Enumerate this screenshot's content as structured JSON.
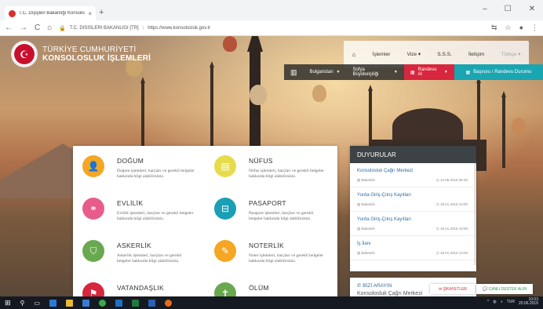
{
  "browser": {
    "tab_title": "T.C. Dışişleri Bakanlığı Konsolos",
    "tab_close": "×",
    "new_tab": "+",
    "nav_back": "←",
    "nav_forward": "→",
    "nav_reload": "C",
    "nav_home": "⌂",
    "security_label": "T.C. DISISLERI BAKANLIGI [TR]",
    "url": "https://www.konsolosluk.gov.tr",
    "window_minimize": "–",
    "window_maximize": "☐",
    "window_close": "✕"
  },
  "site": {
    "logo_line1": "TÜRKİYE CUMHURİYETİ",
    "logo_line2": "KONSOLOSLUK İŞLEMLERİ",
    "accent_red": "#d7263d",
    "accent_teal": "#1aa5b2"
  },
  "topnav": {
    "items": [
      "İşlemler",
      "Vize ▾",
      "S.S.S.",
      "İletişim"
    ],
    "language": "Türkçe ▾"
  },
  "subbar": {
    "country": "Bulgaristan",
    "mission": "Sofya Büyükelçiliği",
    "appointment": "Randevu Al",
    "application": "Başvuru / Randevu Durumu"
  },
  "services": [
    {
      "title": "DOĞUM",
      "desc": "Doğum işlemleri, harçları ve gerekli belgeler hakkında bilgi alabilirsiniz.",
      "icon": "person-icon",
      "glyph": "👤",
      "color": "#f5a623"
    },
    {
      "title": "NÜFUS",
      "desc": "Nüfus işlemleri, harçları ve gerekli belgeler hakkında bilgi alabilirsiniz.",
      "icon": "document-icon",
      "glyph": "▤",
      "color": "#e6dc4b"
    },
    {
      "title": "EVLİLİK",
      "desc": "Evlilik işlemleri, harçları ve gerekli belgeler hakkında bilgi alabilirsiniz.",
      "icon": "couple-icon",
      "glyph": "⚭",
      "color": "#e85c8b"
    },
    {
      "title": "PASAPORT",
      "desc": "Pasaport işlemleri, harçları ve gerekli belgeler hakkında bilgi alabilirsiniz.",
      "icon": "passport-icon",
      "glyph": "⊟",
      "color": "#1a9fb6"
    },
    {
      "title": "ASKERLİK",
      "desc": "Askerlik işlemleri, harçları ve gerekli belgeler hakkında bilgi alabilirsiniz.",
      "icon": "shield-icon",
      "glyph": "⛉",
      "color": "#6aa84f"
    },
    {
      "title": "NOTERLİK",
      "desc": "Noter işlemleri, harçları ve gerekli belgeler hakkında bilgi alabilirsiniz.",
      "icon": "pen-icon",
      "glyph": "✎",
      "color": "#f5a623"
    },
    {
      "title": "VATANDAŞLIK",
      "desc": "",
      "icon": "flag-icon",
      "glyph": "⚑",
      "color": "#d7263d"
    },
    {
      "title": "ÖLÜM",
      "desc": "",
      "icon": "death-icon",
      "glyph": "✝",
      "color": "#6aa84f"
    }
  ],
  "announcements": {
    "title": "DUYURULAR",
    "items": [
      {
        "title": "Konsolosluk Çağrı Merkezi",
        "source": "Bakanlık",
        "date": "14.06.2016 06:33"
      },
      {
        "title": "Yurda Giriş-Çıkış Kayıtları",
        "source": "Bakanlık",
        "date": "19.01.2016 13:00"
      },
      {
        "title": "Yurda Giriş-Çıkış Kayıtları",
        "source": "Bakanlık",
        "date": "19.01.2016 13:00"
      },
      {
        "title": "İş İlanı",
        "source": "Bakanlık",
        "date": "19.01.2016 13:00"
      }
    ]
  },
  "contact": {
    "title": "BİZİ ARAYIN",
    "subtitle": "Konsolosluk Çağrı Merkezi"
  },
  "floating": {
    "complaint": "ŞİKAYETLER",
    "live_support": "CANLI DESTEK ALIN"
  },
  "taskbar": {
    "lang": "TUR",
    "time": "10:03",
    "date": "20.06.2016"
  }
}
